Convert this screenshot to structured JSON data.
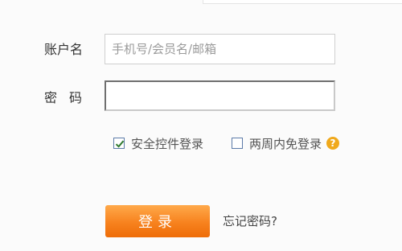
{
  "form": {
    "account_label": "账户名",
    "account_placeholder": "手机号/会员名/邮箱",
    "password_label": "密码",
    "security_control_label": "安全控件登录",
    "security_control_checked": true,
    "two_weeks_label": "两周内免登录",
    "two_weeks_checked": false,
    "help_icon_text": "?",
    "login_button_label": "登录",
    "forgot_password_label": "忘记密码?"
  },
  "colors": {
    "button_orange": "#f7821e",
    "help_icon": "#f0a91c",
    "checkbox_border": "#5b7aa8",
    "checkmark": "#2f7a2f"
  },
  "icons": {
    "checkmark": "checkmark-icon",
    "help": "question-mark-icon"
  }
}
